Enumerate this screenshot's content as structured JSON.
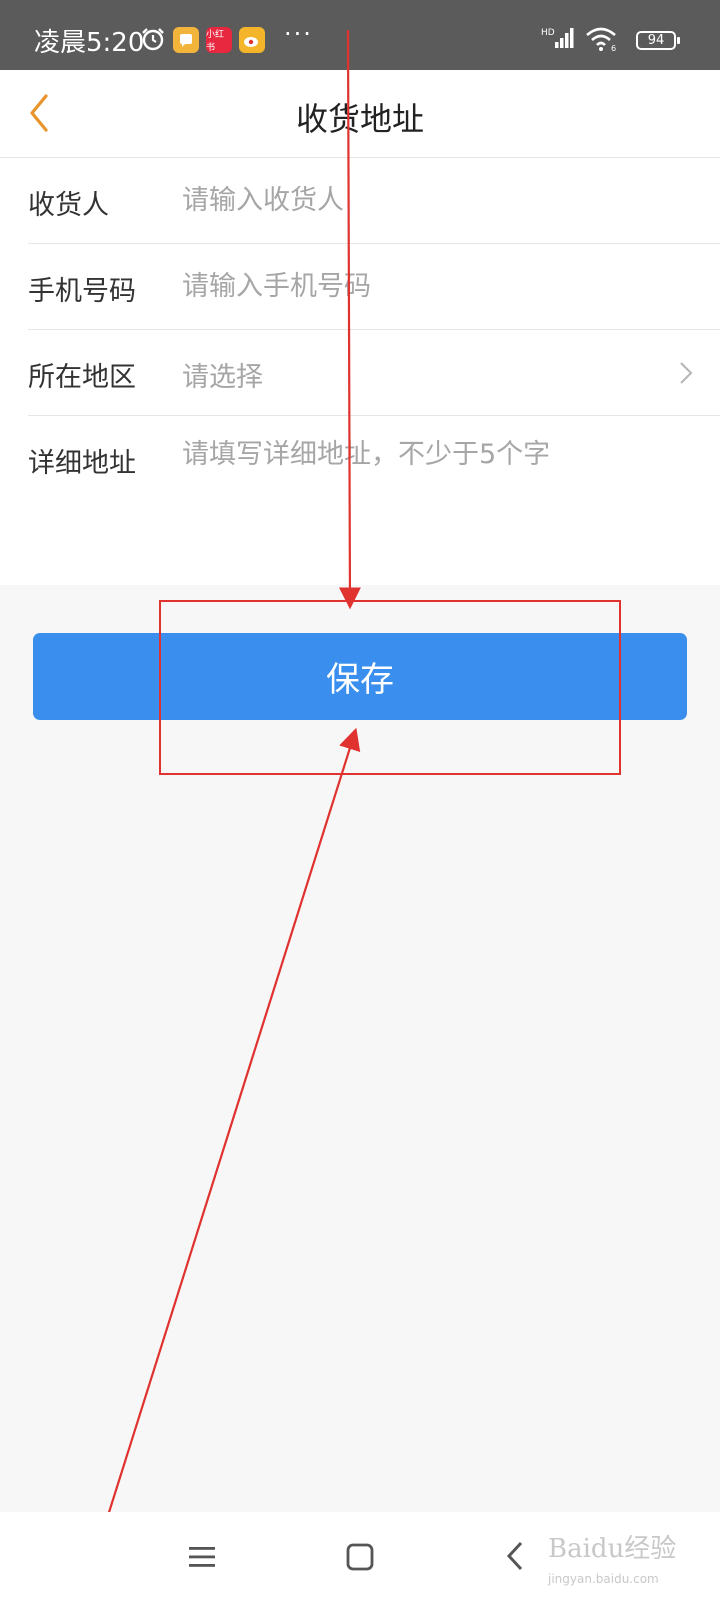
{
  "status_bar": {
    "time": "凌晨5:20",
    "icons": [
      "alarm-icon",
      "notes-app-icon",
      "xiaohongshu-app-icon",
      "weibo-app-icon",
      "more-dots-icon",
      "signal-icon",
      "wifi-icon",
      "battery-icon"
    ],
    "xiaohongshu_badge": "小红书",
    "more": "···",
    "battery": "94"
  },
  "header": {
    "title": "收货地址",
    "accent_color": "#e8942b"
  },
  "form": {
    "rows": [
      {
        "label": "收货人",
        "placeholder": "请输入收货人"
      },
      {
        "label": "手机号码",
        "placeholder": "请输入手机号码"
      },
      {
        "label": "所在地区",
        "placeholder": "请选择"
      },
      {
        "label": "详细地址",
        "placeholder": "请填写详细地址，不少于5个字"
      }
    ]
  },
  "save_button": {
    "label": "保存",
    "color": "#3a8eee"
  },
  "annotation": {
    "color": "#e0322f"
  },
  "nav_bar": {
    "icons": [
      "menu-icon",
      "home-icon",
      "back-icon"
    ]
  },
  "watermark": {
    "text": "Baidu经验",
    "sub": "jingyan.baidu.com"
  }
}
